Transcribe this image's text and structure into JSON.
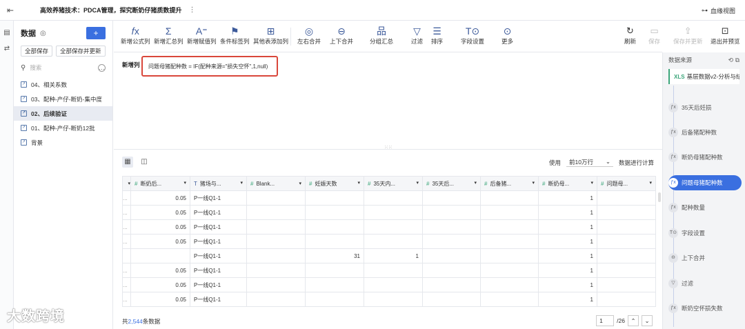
{
  "header": {
    "title": "高效养猪技术：PDCA管理，探究断奶仔猪质数提升",
    "more": "⋮",
    "view_label": "血缘视图"
  },
  "sidebar": {
    "title": "数据",
    "add": "+",
    "save_all": "全部保存",
    "save_all_update": "全部保存并更新",
    "search_placeholder": "搜索",
    "items": [
      "04、相关系数",
      "03、配种-产仔-断奶-集中度",
      "02、后续验证",
      "01、配种-产仔-断奶12批",
      "背景"
    ]
  },
  "toolbar": {
    "formula_col": "新增公式列",
    "summary_col": "新增汇总列",
    "assign_col": "新增赋值列",
    "cond_col": "条件标签列",
    "other_col": "其他表添加列",
    "lr_merge": "左右合并",
    "ud_merge": "上下合并",
    "group": "分组汇总",
    "filter": "过滤",
    "sort": "排序",
    "field": "字段设置",
    "more": "更多",
    "refresh": "刷新",
    "save": "保存",
    "save_update": "保存并更新",
    "exit_preview": "退出并预览"
  },
  "editor": {
    "label": "新增列",
    "formula": "问题母猪配种数 = IF(配种来源=\"损失空怀\",1,null)"
  },
  "grid": {
    "use_label": "使用",
    "rows_select": "前10万行",
    "calc_label": "数据进行计算",
    "columns": [
      "断奶后...",
      "猪场与...",
      "Blank...",
      "妊娠天数",
      "35天内...",
      "35天后...",
      "后备猪...",
      "断奶母...",
      "问题母..."
    ],
    "rows": [
      [
        "...",
        "0.05",
        "P一线Q1-1",
        "",
        "",
        "",
        "",
        "",
        "1",
        ""
      ],
      [
        "...",
        "0.05",
        "P一线Q1-1",
        "",
        "",
        "",
        "",
        "",
        "1",
        ""
      ],
      [
        "...",
        "0.05",
        "P一线Q1-1",
        "",
        "",
        "",
        "",
        "",
        "1",
        ""
      ],
      [
        "...",
        "0.05",
        "P一线Q1-1",
        "",
        "",
        "",
        "",
        "",
        "1",
        ""
      ],
      [
        "",
        "",
        "P一线Q1-1",
        "",
        "31",
        "1",
        "",
        "",
        "1",
        ""
      ],
      [
        "...",
        "0.05",
        "P一线Q1-1",
        "",
        "",
        "",
        "",
        "",
        "1",
        ""
      ],
      [
        "...",
        "0.05",
        "P一线Q1-1",
        "",
        "",
        "",
        "",
        "",
        "1",
        ""
      ],
      [
        "...",
        "0.05",
        "P一线Q1-1",
        "",
        "",
        "",
        "",
        "",
        "1",
        ""
      ]
    ],
    "footer_prefix": "共",
    "footer_count": "2,544",
    "footer_suffix": "条数据",
    "page": "1",
    "page_total": "/26"
  },
  "right_panel": {
    "title": "数据来源",
    "source": "基层数据v2-分析与结...",
    "steps": [
      "35天后妊损",
      "后备猪配种数",
      "断奶母猪配种数",
      "问题母猪配种数",
      "配种数量",
      "字段设置",
      "上下合并",
      "过滤",
      "断奶空怀损失数"
    ]
  },
  "watermark": "大数跨境"
}
